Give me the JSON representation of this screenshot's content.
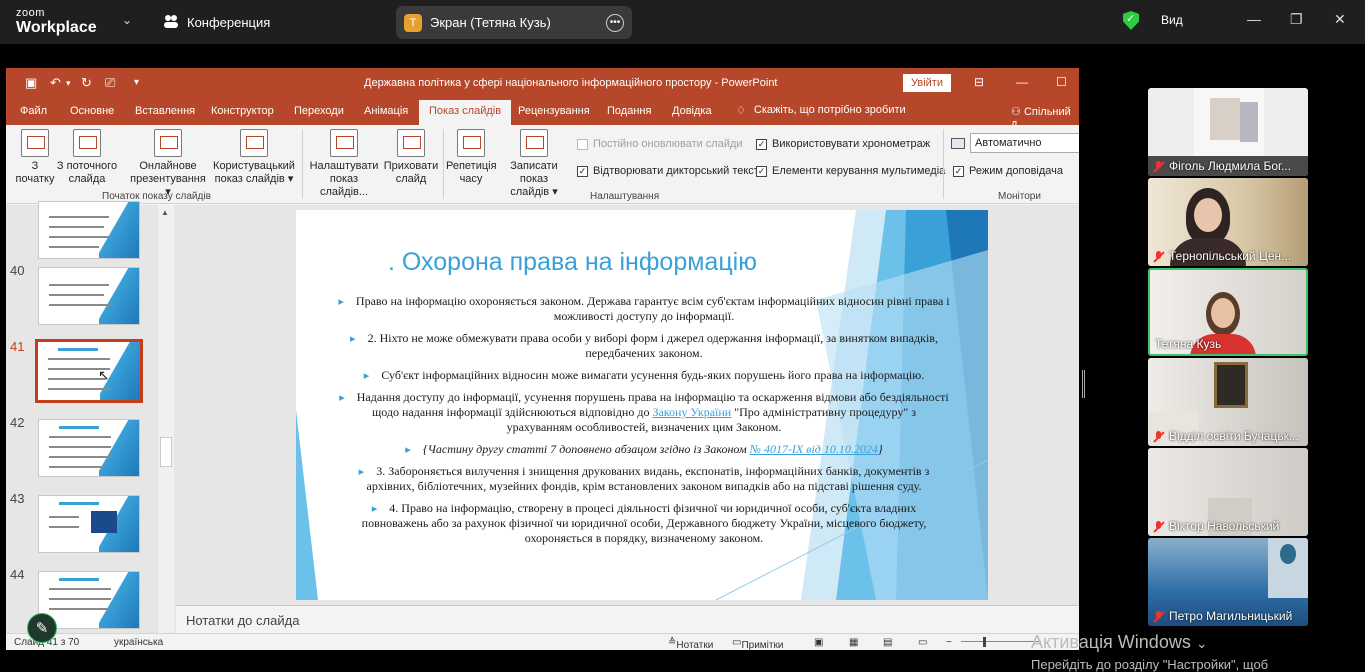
{
  "zoom": {
    "logo_top": "zoom",
    "logo_bottom": "Workplace",
    "meeting_label": "Конференция",
    "share_avatar": "T",
    "share_title": "Экран (Тетяна Кузь)",
    "view_label": "Вид"
  },
  "ppt": {
    "doc_title": "Державна політика у сфері національного інформаційного простору  -  PowerPoint",
    "signin": "Увійти",
    "tabs": [
      "Файл",
      "Основне",
      "Вставлення",
      "Конструктор",
      "Переходи",
      "Анімація",
      "Показ слайдів",
      "Рецензування",
      "Подання",
      "Довідка"
    ],
    "active_tab": "Показ слайдів",
    "tell_me": "Скажіть, що потрібно зробити",
    "share": "Спільний д",
    "ribbon": {
      "btn_from_start_1": "З",
      "btn_from_start_2": "початку",
      "btn_from_current_1": "З поточного",
      "btn_from_current_2": "слайда",
      "btn_online_1": "Онлайнове",
      "btn_online_2": "презентування ▾",
      "btn_custom_1": "Користувацький",
      "btn_custom_2": "показ слайдів ▾",
      "group_start": "Початок показу слайдів",
      "btn_setup_1": "Налаштувати",
      "btn_setup_2": "показ слайдів...",
      "btn_hide_1": "Приховати",
      "btn_hide_2": "слайд",
      "btn_rehearse_1": "Репетиція",
      "btn_rehearse_2": "часу",
      "btn_record_1": "Записати показ",
      "btn_record_2": "слайдів ▾",
      "chk_keep_updated": "Постійно оновлювати слайди",
      "chk_narration": "Відтворювати дикторський текст",
      "chk_timings": "Використовувати хронометраж",
      "chk_media": "Елементи керування мультимедіа",
      "group_setup": "Налаштування",
      "monitor_value": "Автоматично",
      "chk_presenter": "Режим доповідача",
      "group_monitors": "Монітори"
    },
    "thumb_numbers": [
      "40",
      "41",
      "42",
      "43",
      "44"
    ],
    "selected_slide": "41",
    "slide": {
      "title": ". Охорона права на інформацію",
      "p1": "Право на інформацію охороняється законом. Держава гарантує всім суб'єктам інформаційних відносин рівні права і можливості доступу до інформації.",
      "p2": "2. Ніхто не може обмежувати права особи у виборі форм і джерел одержання інформації, за винятком випадків, передбачених законом.",
      "p3": "Суб'єкт інформаційних відносин може вимагати усунення будь-яких порушень його права на інформацію.",
      "p4_a": "Надання доступу до інформації, усунення порушень права на інформацію та оскарження відмови або бездіяльності щодо надання інформації здійснюються відповідно до ",
      "p4_link": "Закону України",
      "p4_b": " \"Про адміністративну процедуру\" з урахуванням особливостей, визначених цим Законом.",
      "p5_a": "{Частину другу статті 7 доповнено абзацом згідно із Законом ",
      "p5_link": "№ 4017-IX від 10.10.2024",
      "p5_b": "}",
      "p6": "3. Забороняється вилучення і знищення друкованих видань, експонатів, інформаційних банків, документів з архівних, бібліотечних, музейних фондів, крім встановлених законом випадків або на підставі рішення суду.",
      "p7": "4. Право на інформацію, створену в процесі діяльності фізичної чи юридичної особи, суб'єкта владних повноважень або за рахунок фізичної чи юридичної особи, Державного бюджету України, місцевого бюджету, охороняється в порядку, визначеному законом."
    },
    "notes": "Нотатки до слайда",
    "status": {
      "slide_count": "Слайд 41 з 70",
      "language": "українська",
      "notes": "Нотатки",
      "comments": "Примітки"
    }
  },
  "participants": [
    {
      "name": "Фіголь Людмила Бог...",
      "muted": true
    },
    {
      "name": "Тернопільський Цен...",
      "muted": true
    },
    {
      "name": "Тетяна Кузь",
      "muted": false
    },
    {
      "name": "Відділ освіти Бучацьк...",
      "muted": true
    },
    {
      "name": "Віктор Навольський",
      "muted": true
    },
    {
      "name": "Петро Магильницький",
      "muted": true
    }
  ],
  "watermark": {
    "line1": "Активація Windows",
    "line2": "Перейдіть до розділу \"Настройки\", щоб"
  },
  "colors": {
    "ppt_accent": "#b7472a",
    "slide_accent": "#3aa0d8",
    "active_speaker": "#3ec46d",
    "muted": "#ee3333"
  }
}
